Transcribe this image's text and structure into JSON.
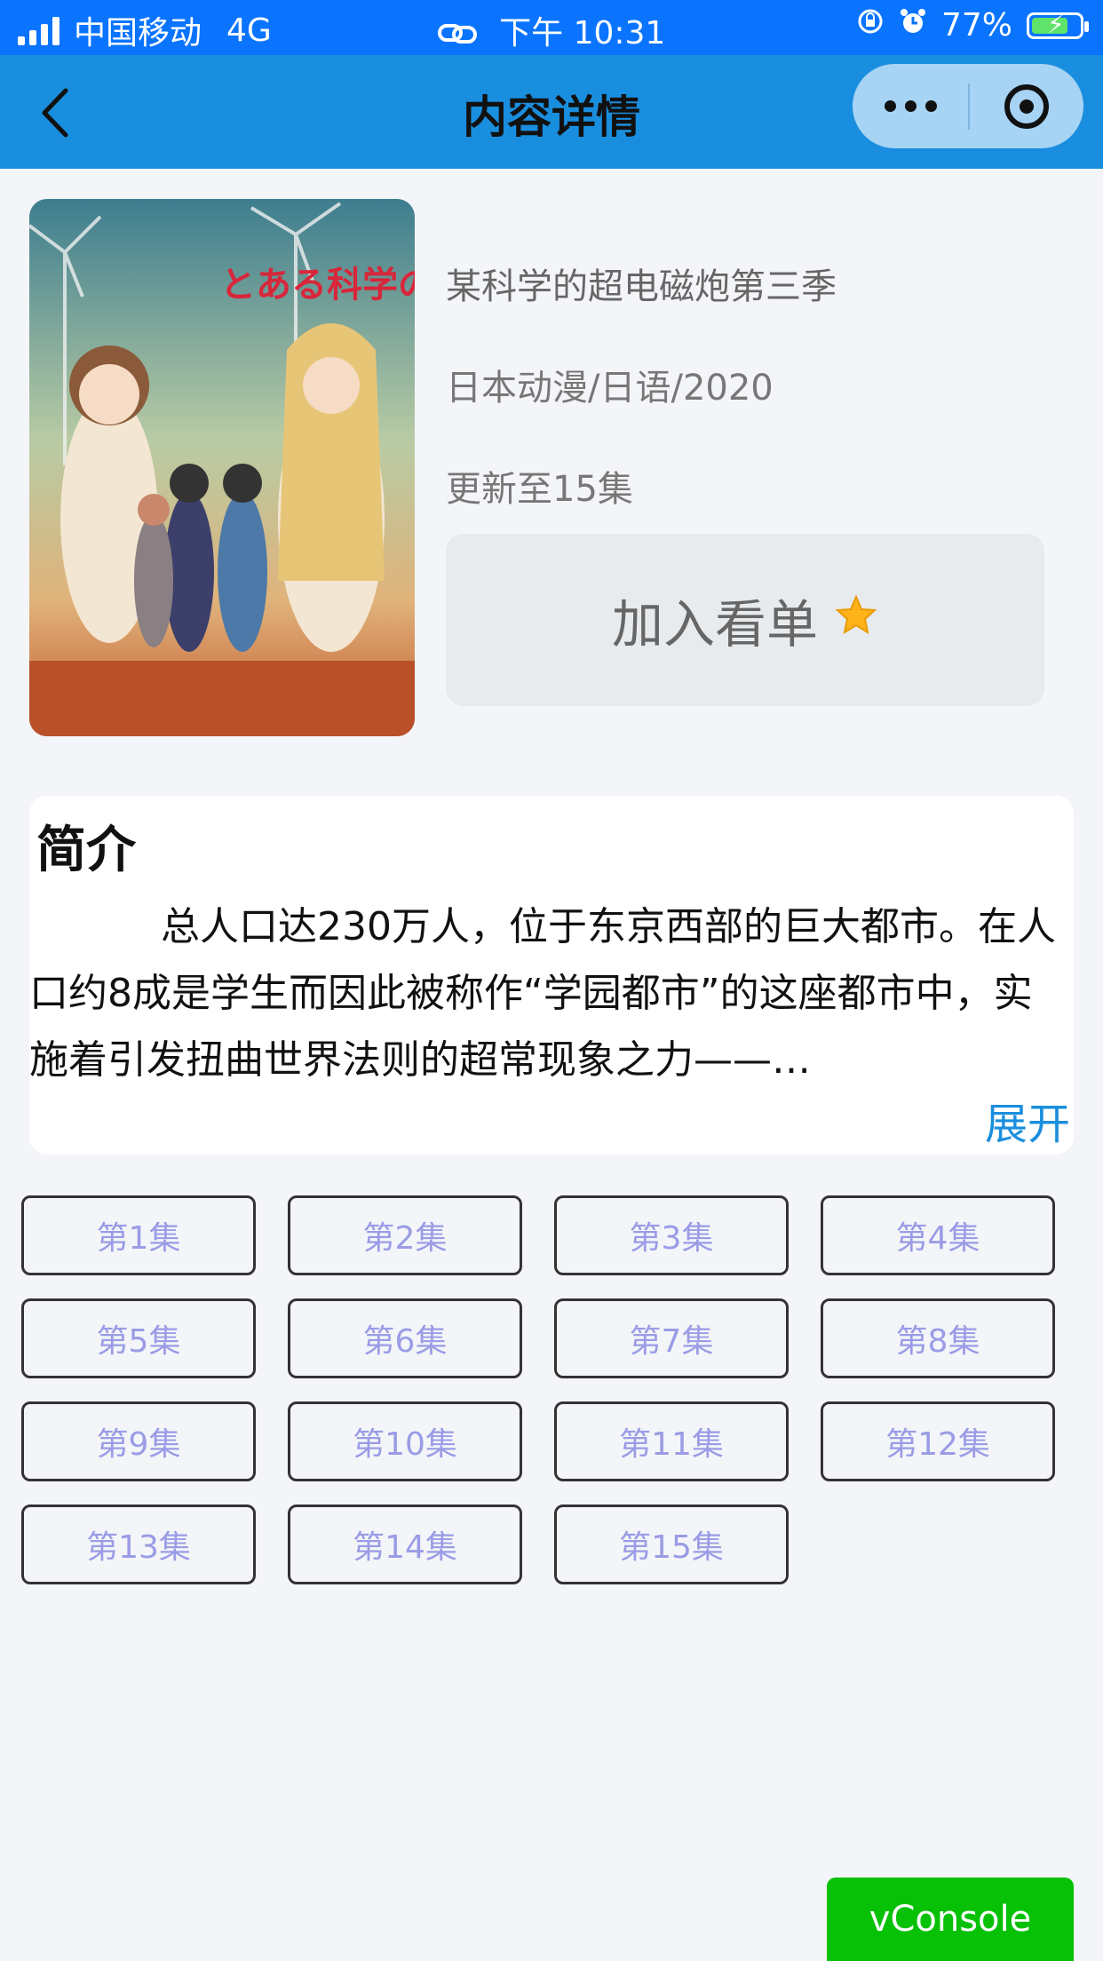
{
  "status_bar": {
    "carrier": "中国移动",
    "network": "4G",
    "time": "下午 10:31",
    "battery": "77%",
    "battery_level": 0.77
  },
  "nav": {
    "title": "内容详情"
  },
  "detail": {
    "title": "某科学的超电磁炮第三季",
    "meta": "日本动漫/日语/2020",
    "update": "更新至15集",
    "add_label": "加入看单",
    "poster_title": "とある科学の超電磁砲T"
  },
  "intro": {
    "heading": "简介",
    "text": "总人口达230万人，位于东京西部的巨大都市。在人口约8成是学生而因此被称作“学园都市”的这座都市中，实施着引发扭曲世界法则的超常现象之力——…",
    "expand_label": "展开"
  },
  "episodes": [
    "第1集",
    "第2集",
    "第3集",
    "第4集",
    "第5集",
    "第6集",
    "第7集",
    "第8集",
    "第9集",
    "第10集",
    "第11集",
    "第12集",
    "第13集",
    "第14集",
    "第15集"
  ],
  "vconsole_label": "vConsole",
  "colors": {
    "status_bar": "#0a74ff",
    "nav_bar": "#1a8ede",
    "episode_text": "#9a9ce6",
    "vconsole": "#06c106",
    "expand": "#1a8ede",
    "star": "#ffb21a"
  }
}
